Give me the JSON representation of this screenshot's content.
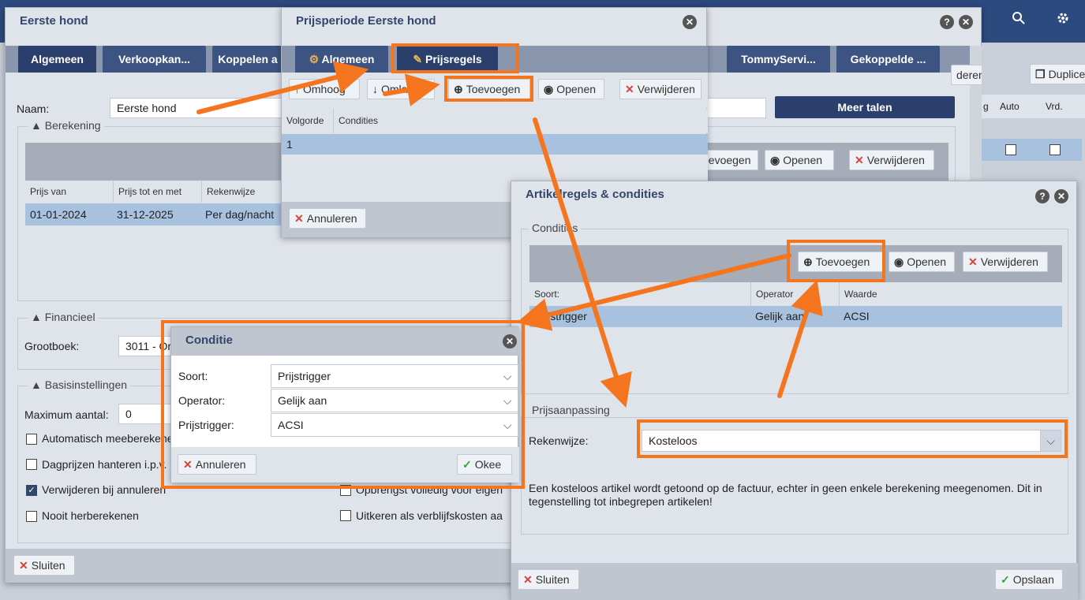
{
  "topbar": {
    "search_icon": "search-icon",
    "settings_icon": "gear-icon"
  },
  "main": {
    "title": "Eerste hond",
    "tabs": [
      "Algemeen",
      "Verkoopkan...",
      "Koppelen a",
      "TommyServi...",
      "Gekoppelde ..."
    ],
    "toolbar": {
      "delete_label": "deren",
      "duplicate_label": "Duplice"
    },
    "naam_label": "Naam:",
    "naam_value": "Eerste hond",
    "meer_talen": "Meer talen",
    "right_cols": [
      "g",
      "Auto",
      "Vrd."
    ],
    "berekening_legend": "Berekening",
    "ber_toolbar": {
      "add": "oevoegen",
      "open": "Openen",
      "delete": "Verwijderen"
    },
    "ber_cols": [
      "Prijs van",
      "Prijs tot en met",
      "Rekenwijze"
    ],
    "ber_row": [
      "01-01-2024",
      "31-12-2025",
      "Per dag/nacht"
    ],
    "financieel_legend": "Financieel",
    "grootboek_label": "Grootboek:",
    "grootboek_value": "3011 - Or",
    "basis_legend": "Basisinstellingen",
    "max_label": "Maximum aantal:",
    "max_value": "0",
    "checks": [
      {
        "label": "Automatisch meeberekenen",
        "on": false
      },
      {
        "label": "Dagprijzen hanteren i.p.v.",
        "on": false
      },
      {
        "label": "Verwijderen bij annuleren",
        "on": true
      },
      {
        "label": "Nooit herberekenen",
        "on": false
      }
    ],
    "checks_right": [
      {
        "label": "Opbrengst volledig voor eigen",
        "on": false
      },
      {
        "label": "Uitkeren als verblijfskosten aa",
        "on": false
      }
    ],
    "sluiten": "Sluiten"
  },
  "prijsperiode": {
    "title": "Prijsperiode Eerste hond",
    "tabs": [
      "Algemeen",
      "Prijsregels"
    ],
    "toolbar": [
      "Omhoog",
      "Omlaag",
      "Toevoegen",
      "Openen",
      "Verwijderen"
    ],
    "cols": [
      "Volgorde",
      "Condities"
    ],
    "row": [
      "1",
      ""
    ],
    "annuleren": "Annuleren"
  },
  "artikel": {
    "title": "Artikelregels & condities",
    "condities_legend": "Condities",
    "toolbar": [
      "Toevoegen",
      "Openen",
      "Verwijderen"
    ],
    "cols": [
      "Soort:",
      "Operator",
      "Waarde"
    ],
    "row": [
      "Prijstrigger",
      "Gelijk aan",
      "ACSI"
    ],
    "prijsaanpassing_legend": "Prijsaanpassing",
    "rekenwijze_label": "Rekenwijze:",
    "rekenwijze_value": "Kosteloos",
    "description": "Een kosteloos artikel wordt getoond op de factuur, echter in geen enkele berekening meegenomen. Dit in tegenstelling tot inbegrepen artikelen!",
    "sluiten": "Sluiten",
    "opslaan": "Opslaan"
  },
  "conditie": {
    "title": "Conditie",
    "fields": [
      {
        "label": "Soort:",
        "value": "Prijstrigger"
      },
      {
        "label": "Operator:",
        "value": "Gelijk aan"
      },
      {
        "label": "Prijstrigger:",
        "value": "ACSI"
      }
    ],
    "annuleren": "Annuleren",
    "okee": "Okee"
  },
  "colors": {
    "accent": "#2a3f6c",
    "highlight": "#f5751f",
    "selected_row": "#a7c1de"
  }
}
